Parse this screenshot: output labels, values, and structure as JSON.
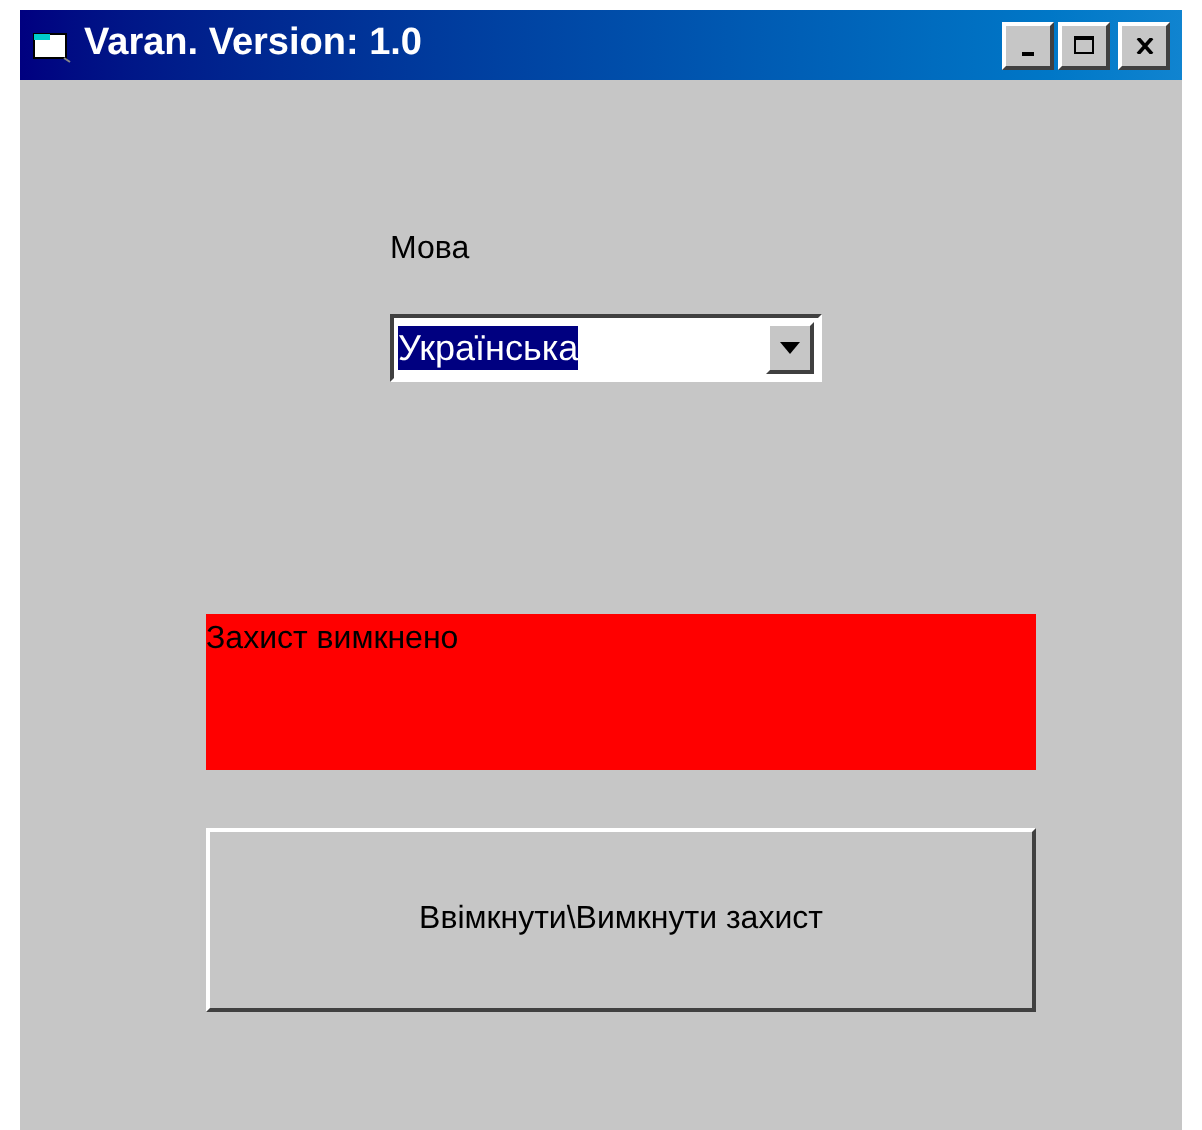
{
  "window": {
    "title": "Varan. Version: 1.0",
    "controls": [
      {
        "kind": "minimize"
      },
      {
        "kind": "maximize"
      },
      {
        "kind": "close"
      }
    ]
  },
  "language": {
    "label": "Мова",
    "value": "Українська",
    "text_selected": true
  },
  "status": {
    "text": "Захист вимкнено",
    "on": false
  },
  "toggle_button": {
    "label": "Ввімкнути\\Вимкнути захист"
  }
}
